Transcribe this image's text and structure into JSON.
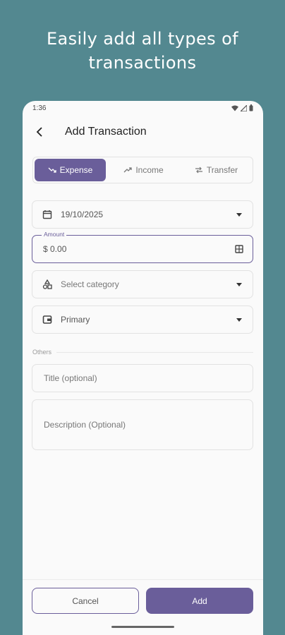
{
  "headline": {
    "line1": "Easily add all types of",
    "line2": "transactions"
  },
  "status_bar": {
    "time": "1:36"
  },
  "app_bar": {
    "title": "Add Transaction"
  },
  "type_tabs": [
    {
      "label": "Expense",
      "icon": "trending-down-icon",
      "selected": true
    },
    {
      "label": "Income",
      "icon": "trending-up-icon",
      "selected": false
    },
    {
      "label": "Transfer",
      "icon": "swap-icon",
      "selected": false
    }
  ],
  "form": {
    "date": {
      "value": "19/10/2025",
      "icon": "calendar-icon"
    },
    "amount": {
      "label": "Amount",
      "value": "$ 0.00",
      "icon": "calculator-icon"
    },
    "category": {
      "placeholder": "Select category",
      "icon": "category-icon"
    },
    "account": {
      "value": "Primary",
      "icon": "wallet-icon"
    },
    "others_label": "Others",
    "title": {
      "placeholder": "Title (optional)"
    },
    "description": {
      "placeholder": "Description (Optional)"
    }
  },
  "actions": {
    "cancel_label": "Cancel",
    "add_label": "Add"
  },
  "colors": {
    "background": "#538890",
    "accent": "#6a5e9a",
    "surface": "#fafafa"
  }
}
